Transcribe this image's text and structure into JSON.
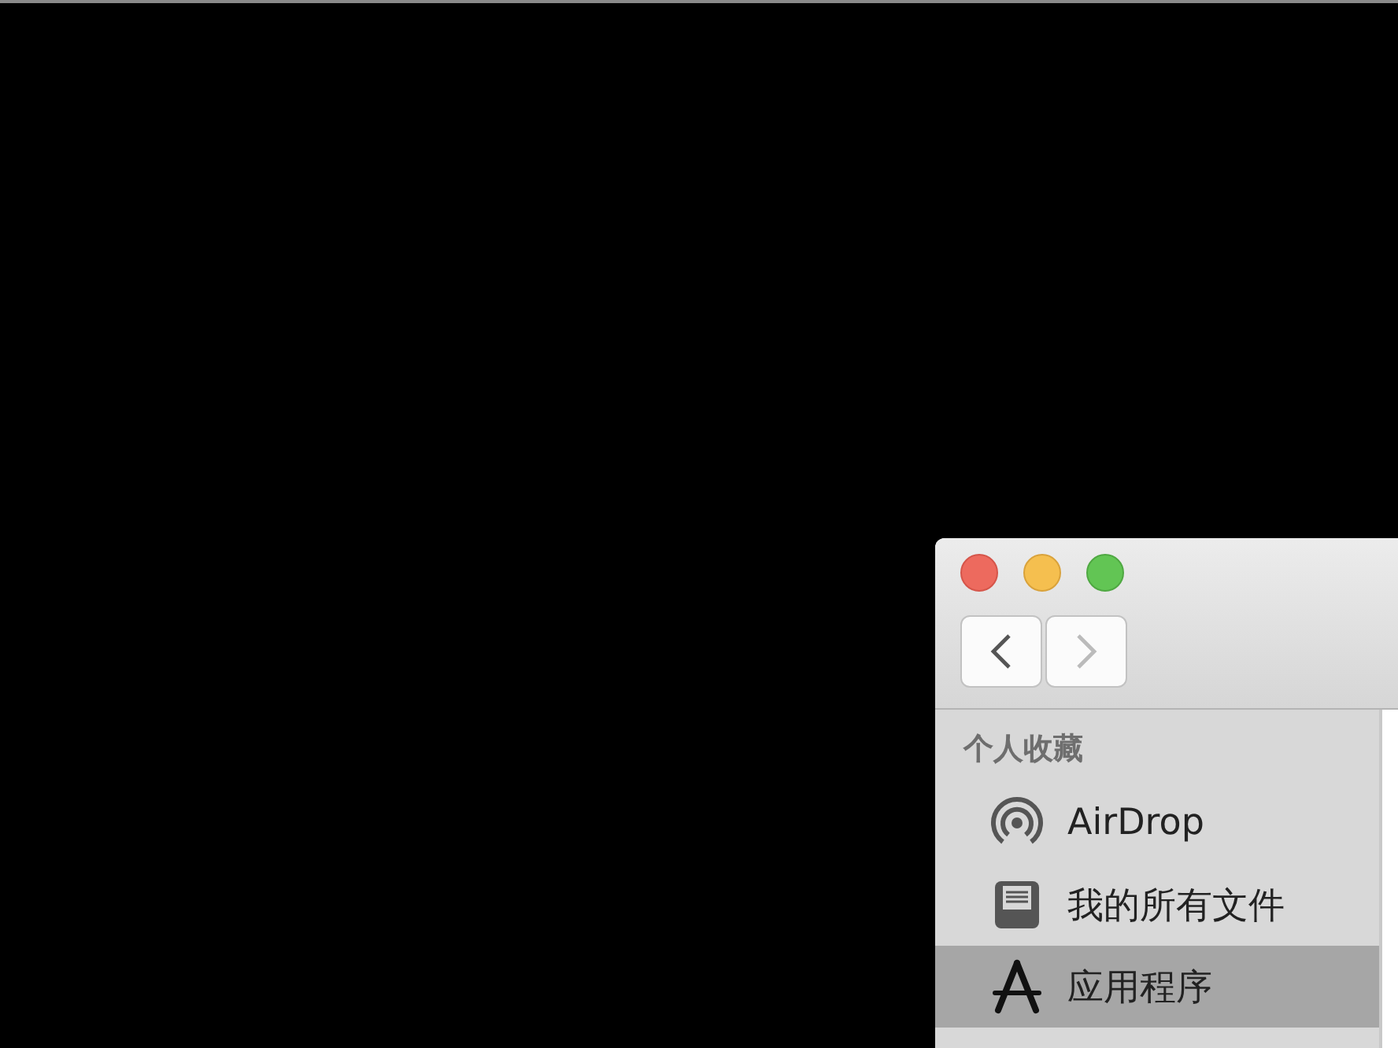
{
  "window": {
    "nav_buttons": [
      {
        "kind": "back",
        "disabled": false
      },
      {
        "kind": "forward",
        "disabled": true
      }
    ]
  },
  "sidebar": {
    "section_title": "个人收藏",
    "items": [
      {
        "kind": "airdrop",
        "label": "AirDrop",
        "selected": false
      },
      {
        "kind": "documents",
        "label": "我的所有文件",
        "selected": false
      },
      {
        "kind": "applications",
        "label": "应用程序",
        "selected": true
      }
    ]
  }
}
